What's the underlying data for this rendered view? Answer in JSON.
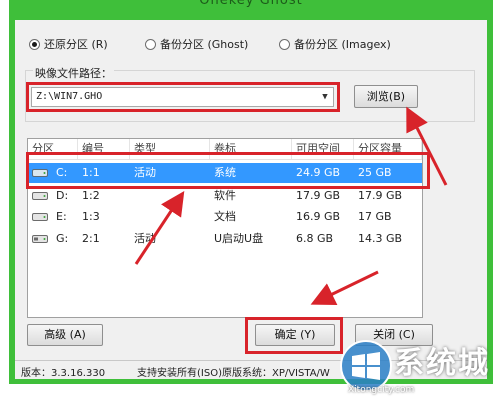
{
  "window": {
    "title": "Onekey Ghost"
  },
  "mode_options": [
    {
      "label": "还原分区 (R)",
      "checked": true
    },
    {
      "label": "备份分区 (Ghost)",
      "checked": false
    },
    {
      "label": "备份分区 (Imagex)",
      "checked": false
    }
  ],
  "image_path": {
    "label": "映像文件路径：",
    "value": "Z:\\WIN7.GHO",
    "browse_label": "浏览(B)"
  },
  "partition_table": {
    "columns": [
      "分区",
      "编号",
      "类型",
      "卷标",
      "可用空间",
      "分区容量"
    ],
    "rows": [
      {
        "drive": "C:",
        "number": "1:1",
        "type": "活动",
        "label": "系统",
        "free": "24.9 GB",
        "capacity": "25 GB",
        "selected": true
      },
      {
        "drive": "D:",
        "number": "1:2",
        "type": "",
        "label": "软件",
        "free": "17.9 GB",
        "capacity": "17.9 GB",
        "selected": false
      },
      {
        "drive": "E:",
        "number": "1:3",
        "type": "",
        "label": "文档",
        "free": "16.9 GB",
        "capacity": "17 GB",
        "selected": false
      },
      {
        "drive": "G:",
        "number": "2:1",
        "type": "活动",
        "label": "U启动U盘",
        "free": "6.8 GB",
        "capacity": "14.3 GB",
        "selected": false
      }
    ]
  },
  "buttons": {
    "advanced": "高级 (A)",
    "ok": "确定 (Y)",
    "close": "关闭 (C)"
  },
  "status": {
    "version": "版本：3.3.16.330",
    "support": "支持安装所有(ISO)原版系统：XP/VISTA/W"
  },
  "watermark": {
    "brand": "系统城",
    "site": "Xitongcity.com"
  },
  "colors": {
    "frame": "#3fbf3a",
    "selection": "#3398ff",
    "annotation": "#d8232a"
  }
}
